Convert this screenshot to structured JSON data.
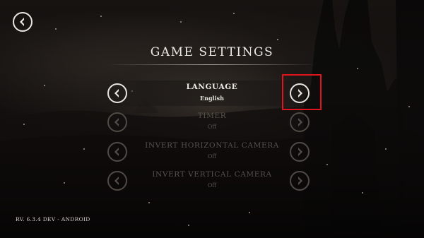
{
  "header": {
    "title": "GAME SETTINGS",
    "back_icon": "chevron-left-icon"
  },
  "settings": [
    {
      "label": "LANGUAGE",
      "value": "English",
      "state": "active"
    },
    {
      "label": "TIMER",
      "value": "Off",
      "state": "dim"
    },
    {
      "label": "INVERT HORIZONTAL CAMERA",
      "value": "Off",
      "state": "dim"
    },
    {
      "label": "INVERT VERTICAL CAMERA",
      "value": "Off",
      "state": "dim"
    }
  ],
  "footer": {
    "version": "RV. 6.3.4 DEV - ANDROID"
  },
  "colors": {
    "active_text": "#efebe5",
    "dim_text": "#57514c",
    "highlight": "#e0141c"
  }
}
